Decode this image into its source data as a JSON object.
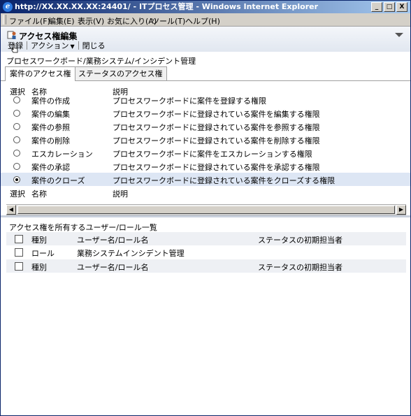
{
  "window": {
    "title": "http://XX.XX.XX.XX:24401/ - ITプロセス管理 - Windows Internet Explorer",
    "buttons": {
      "minimize": "_",
      "maximize": "□",
      "close": "X"
    }
  },
  "menubar": [
    {
      "label": "ファイル(F)"
    },
    {
      "label": "編集(E)"
    },
    {
      "label": "表示(V)"
    },
    {
      "label": "お気に入り(A)"
    },
    {
      "label": "ツール(T)"
    },
    {
      "label": "ヘルプ(H)"
    }
  ],
  "header": {
    "title": "アクセス権編集",
    "toolbar": {
      "register": "登録",
      "action": "アクション",
      "close": "閉じる"
    }
  },
  "breadcrumb": "プロセスワークボード/業務システム/インシデント管理",
  "tabs": [
    {
      "label": "案件のアクセス権",
      "active": true
    },
    {
      "label": "ステータスのアクセス権",
      "active": false
    }
  ],
  "permissions": {
    "columns": {
      "select": "選択",
      "name": "名称",
      "description": "説明"
    },
    "rows": [
      {
        "name": "案件の作成",
        "description": "プロセスワークボードに案件を登録する権限",
        "selected": false
      },
      {
        "name": "案件の編集",
        "description": "プロセスワークボードに登録されている案件を編集する権限",
        "selected": false
      },
      {
        "name": "案件の参照",
        "description": "プロセスワークボードに登録されている案件を参照する権限",
        "selected": false
      },
      {
        "name": "案件の削除",
        "description": "プロセスワークボードに登録されている案件を削除する権限",
        "selected": false
      },
      {
        "name": "エスカレーション",
        "description": "プロセスワークボードに案件をエスカレーションする権限",
        "selected": false
      },
      {
        "name": "案件の承認",
        "description": "プロセスワークボードに登録されている案件を承認する権限",
        "selected": false
      },
      {
        "name": "案件のクローズ",
        "description": "プロセスワークボードに登録されている案件をクローズする権限",
        "selected": true
      }
    ],
    "footer": {
      "select": "選択",
      "name": "名称",
      "description": "説明"
    }
  },
  "users": {
    "title": "アクセス権を所有するユーザー/ロール一覧",
    "columns": {
      "type": "種別",
      "name": "ユーザー名/ロール名",
      "status": "ステータスの初期担当者"
    },
    "rows": [
      {
        "type": "ロール",
        "name": "業務システムインシデント管理",
        "status": ""
      }
    ],
    "footer": {
      "type": "種別",
      "name": "ユーザー名/ロール名",
      "status": "ステータスの初期担当者"
    }
  }
}
